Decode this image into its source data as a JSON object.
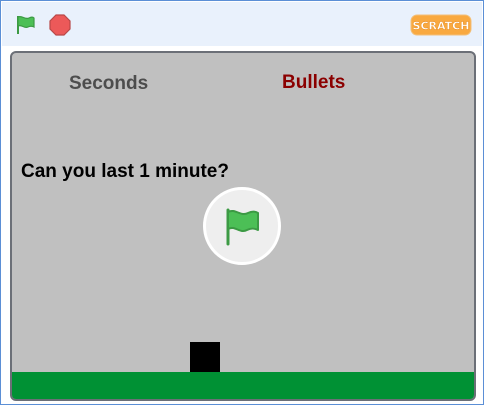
{
  "toolbar": {
    "green_flag_icon": "green-flag-icon",
    "stop_icon": "stop-icon",
    "logo_text": "SCRATCH"
  },
  "stage": {
    "variables": {
      "seconds_label": "Seconds",
      "bullets_label": "Bullets"
    },
    "prompt_text": "Can you last 1 minute?",
    "overlay_icon": "green-flag-icon"
  },
  "colors": {
    "topbar_bg": "#e9f1fc",
    "stage_bg": "#c0c0c0",
    "ground": "#009134",
    "seconds_text": "#4d4d4d",
    "bullets_text": "#8b0000",
    "flag_green": "#4cbf56",
    "stop_red": "#ec5959",
    "logo_orange": "#f9a940"
  }
}
